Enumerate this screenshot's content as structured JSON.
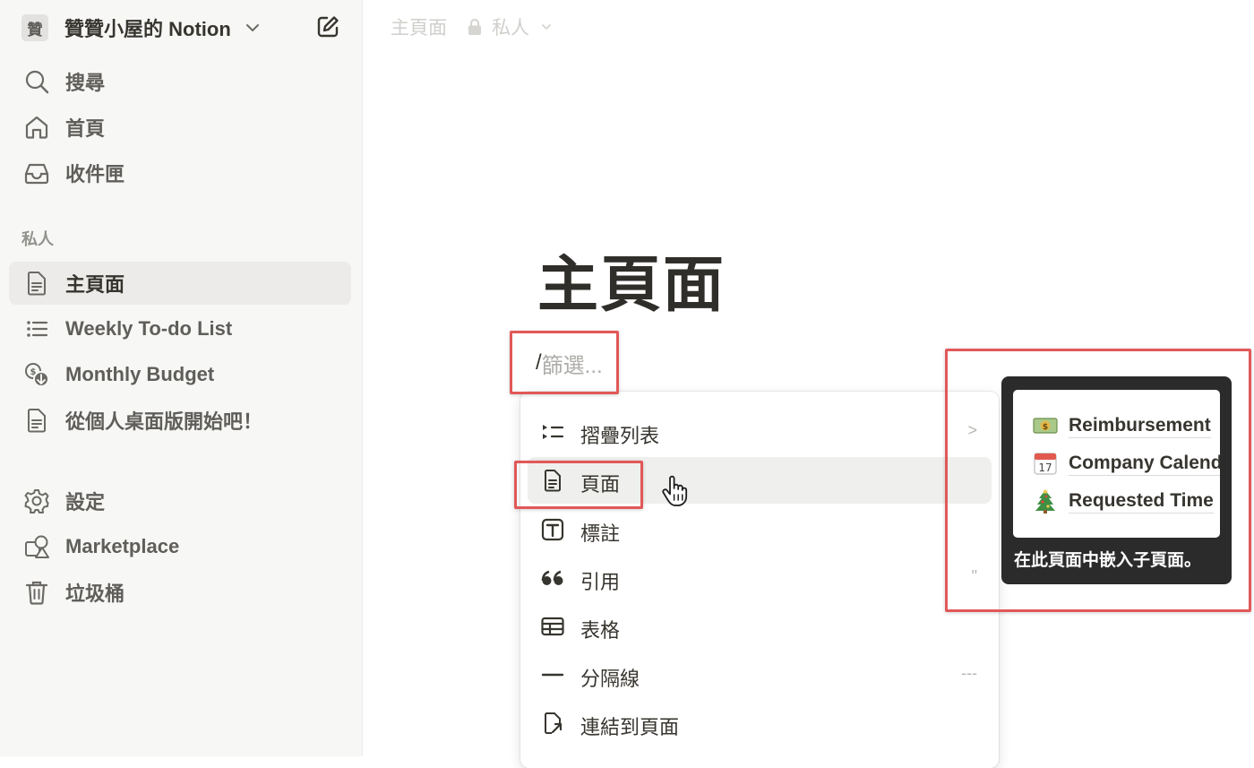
{
  "workspace": {
    "avatar_char": "贊",
    "name": "贊贊小屋的 Notion"
  },
  "sidebar": {
    "top_items": [
      {
        "label": "搜尋",
        "icon": "search-icon"
      },
      {
        "label": "首頁",
        "icon": "home-icon"
      },
      {
        "label": "收件匣",
        "icon": "inbox-icon"
      }
    ],
    "section_label": "私人",
    "private_items": [
      {
        "label": "主頁面",
        "icon": "page-icon",
        "active": true
      },
      {
        "label": "Weekly To-do List",
        "icon": "list-icon"
      },
      {
        "label": "Monthly Budget",
        "icon": "budget-icon"
      },
      {
        "label": "從個人桌面版開始吧！",
        "icon": "page-icon"
      }
    ],
    "bottom_items": [
      {
        "label": "設定",
        "icon": "gear-icon"
      },
      {
        "label": "Marketplace",
        "icon": "marketplace-icon"
      },
      {
        "label": "垃圾桶",
        "icon": "trash-icon"
      }
    ]
  },
  "topbar": {
    "breadcrumb": "主頁面",
    "privacy": "私人"
  },
  "page": {
    "title": "主頁面"
  },
  "command": {
    "slash": "/",
    "placeholder": "篩選..."
  },
  "menu": {
    "items": [
      {
        "label": "摺疊列表",
        "icon": "toggle-list-icon",
        "hint": ">"
      },
      {
        "label": "頁面",
        "icon": "page-icon",
        "hint": ""
      },
      {
        "label": "標註",
        "icon": "callout-icon",
        "hint": ""
      },
      {
        "label": "引用",
        "icon": "quote-icon",
        "hint": "\""
      },
      {
        "label": "表格",
        "icon": "table-icon",
        "hint": ""
      },
      {
        "label": "分隔線",
        "icon": "divider-icon",
        "hint": "---"
      },
      {
        "label": "連結到頁面",
        "icon": "link-page-icon",
        "hint": ""
      }
    ],
    "hovered_index": 1
  },
  "tooltip": {
    "preview_rows": [
      {
        "emoji": "money-emoji",
        "text": "Reimbursement"
      },
      {
        "emoji": "calendar-emoji",
        "calendar_day": "17",
        "text": "Company Calendar"
      },
      {
        "emoji": "christmas-tree-emoji",
        "text": "Requested Time"
      }
    ],
    "caption": "在此頁面中嵌入子頁面。"
  },
  "colors": {
    "highlight": "#e15858",
    "sidebar_bg": "#f7f7f5",
    "tooltip_bg": "#2b2b2b"
  }
}
